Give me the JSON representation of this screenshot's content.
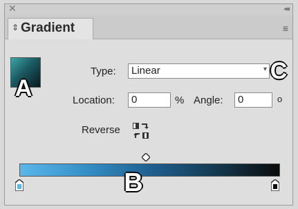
{
  "panel": {
    "tab_label": "Gradient",
    "tab_arrows": "⇕",
    "menu_icon": "≡",
    "close_glyph": "✕",
    "collapse_glyph": "◂◂"
  },
  "fields": {
    "type_label": "Type:",
    "type_value": "Linear",
    "location_label": "Location:",
    "location_value": "0",
    "location_unit": "%",
    "angle_label": "Angle:",
    "angle_value": "0",
    "angle_unit": "o",
    "reverse_label": "Reverse"
  },
  "callouts": {
    "a": "A",
    "b": "B",
    "c": "C"
  },
  "gradient": {
    "start_color": "#5bb7e8",
    "end_color": "#0b0b0b"
  }
}
